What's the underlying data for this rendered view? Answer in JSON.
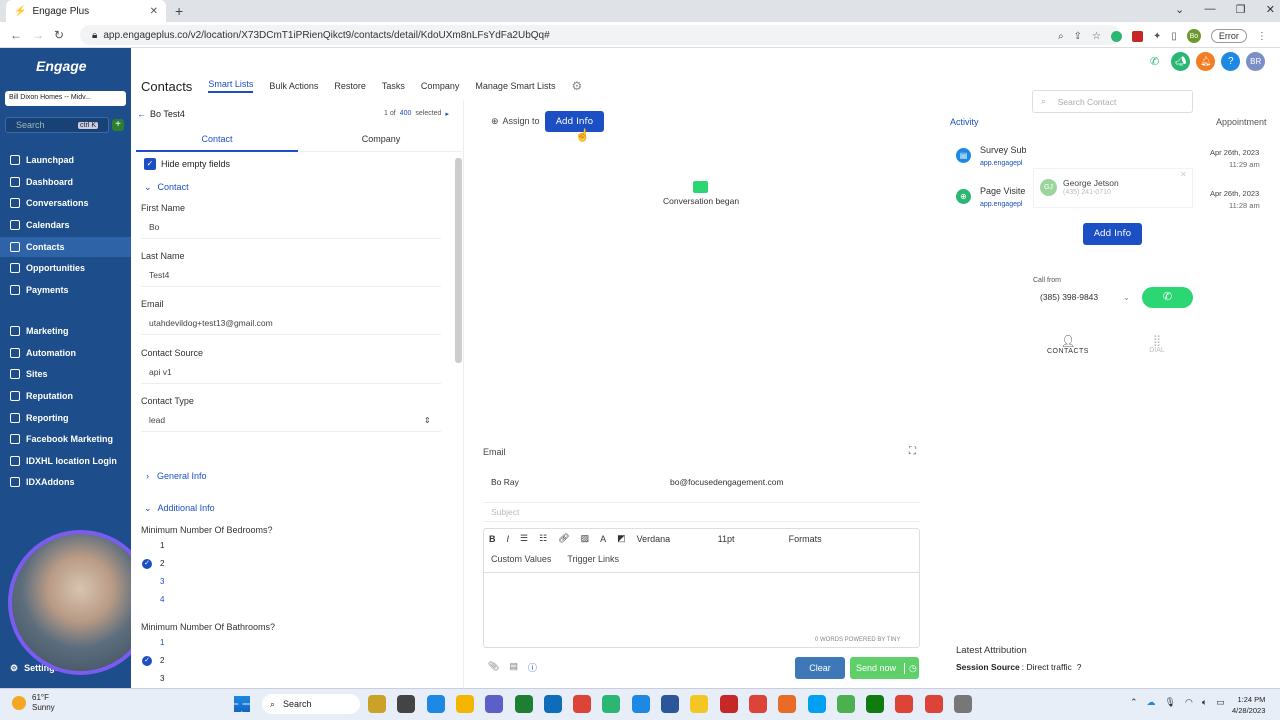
{
  "browser": {
    "tab_title": "Engage Plus",
    "url": "app.engageplus.co/v2/location/X73DCmT1iPRienQikct9/contacts/detail/KdoUXm8nLFsYdFa2UbQq#",
    "profile": "Bo",
    "error_label": "Error"
  },
  "sidebar": {
    "logo": "Engage",
    "account": "Bill Dixon Homes -- Midv...",
    "search_placeholder": "Search",
    "search_shortcut": "ctrl K",
    "items": [
      {
        "label": "Launchpad",
        "icon": "rocket-icon"
      },
      {
        "label": "Dashboard",
        "icon": "dashboard-icon"
      },
      {
        "label": "Conversations",
        "icon": "chat-icon"
      },
      {
        "label": "Calendars",
        "icon": "calendar-icon"
      },
      {
        "label": "Contacts",
        "icon": "contacts-icon"
      },
      {
        "label": "Opportunities",
        "icon": "filter-icon"
      },
      {
        "label": "Payments",
        "icon": "payments-icon"
      },
      {
        "label": "Marketing",
        "icon": "send-icon"
      },
      {
        "label": "Automation",
        "icon": "automation-icon"
      },
      {
        "label": "Sites",
        "icon": "sites-icon"
      },
      {
        "label": "Reputation",
        "icon": "star-icon"
      },
      {
        "label": "Reporting",
        "icon": "chart-icon"
      },
      {
        "label": "Facebook Marketing",
        "icon": "facebook-icon"
      },
      {
        "label": "IDXHL location Login",
        "icon": "id-icon"
      },
      {
        "label": "IDXAddons",
        "icon": "addon-icon"
      }
    ],
    "settings": "Settings"
  },
  "header": {
    "title": "Contacts",
    "tabs": [
      "Smart Lists",
      "Bulk Actions",
      "Restore",
      "Tasks",
      "Company",
      "Manage Smart Lists"
    ],
    "avatar": "BR"
  },
  "contact_panel": {
    "back_label": "Bo Test4",
    "pager_prefix": "1 of",
    "pager_total": "400",
    "pager_suffix": "selected",
    "tabs": [
      "Contact",
      "Company"
    ],
    "hide_empty": "Hide empty fields",
    "section": "Contact",
    "fields": [
      {
        "label": "First Name",
        "value": "Bo"
      },
      {
        "label": "Last Name",
        "value": "Test4"
      },
      {
        "label": "Email",
        "value": "utahdevildog+test13@gmail.com"
      },
      {
        "label": "Contact Source",
        "value": "api v1"
      },
      {
        "label": "Contact Type",
        "value": "lead"
      }
    ],
    "general_info": "General Info",
    "additional_info": "Additional Info",
    "bedrooms_label": "Minimum Number Of Bedrooms?",
    "bedrooms_options": [
      "1",
      "2",
      "3",
      "4"
    ],
    "bathrooms_label": "Minimum Number Of Bathrooms?",
    "bathrooms_options": [
      "1",
      "2",
      "3"
    ]
  },
  "conversation": {
    "assign_to": "Assign to",
    "add_info": "Add Info",
    "began": "Conversation began",
    "email_label": "Email",
    "from_name": "Bo Ray",
    "from_email": "bo@focusedengagement.com",
    "subject_placeholder": "Subject",
    "font": "Verdana",
    "size": "11pt",
    "formats": "Formats",
    "custom_values": "Custom Values",
    "trigger_links": "Trigger Links",
    "word_count": "0 WORDS POWERED BY TINY",
    "clear": "Clear",
    "send": "Send now"
  },
  "activity": {
    "tab": "Activity",
    "tab2": "Appointment",
    "items": [
      {
        "title": "Survey Sub",
        "sub": "app.engagepl",
        "date": "Apr 26th, 2023",
        "time": "11:29 am"
      },
      {
        "title": "Page Visite",
        "sub": "app.engagepl",
        "date": "Apr 26th, 2023",
        "time": "11:28 am"
      }
    ],
    "latest_attribution": "Latest Attribution",
    "session_source_label": "Session Source",
    "session_source_value": ": Direct traffic"
  },
  "dialer": {
    "search_placeholder": "Search Contact",
    "contact_initials": "GJ",
    "contact_name": "George Jetson",
    "contact_phone": "(435) 241-0710",
    "add_info": "Add Info",
    "call_from": "Call from",
    "call_number": "(385) 398-9843",
    "contacts_tab": "CONTACTS",
    "dial_tab": "DIAL"
  },
  "taskbar": {
    "weather_temp": "61°F",
    "weather_desc": "Sunny",
    "search": "Search",
    "time": "1:24 PM",
    "date": "4/28/2023"
  }
}
